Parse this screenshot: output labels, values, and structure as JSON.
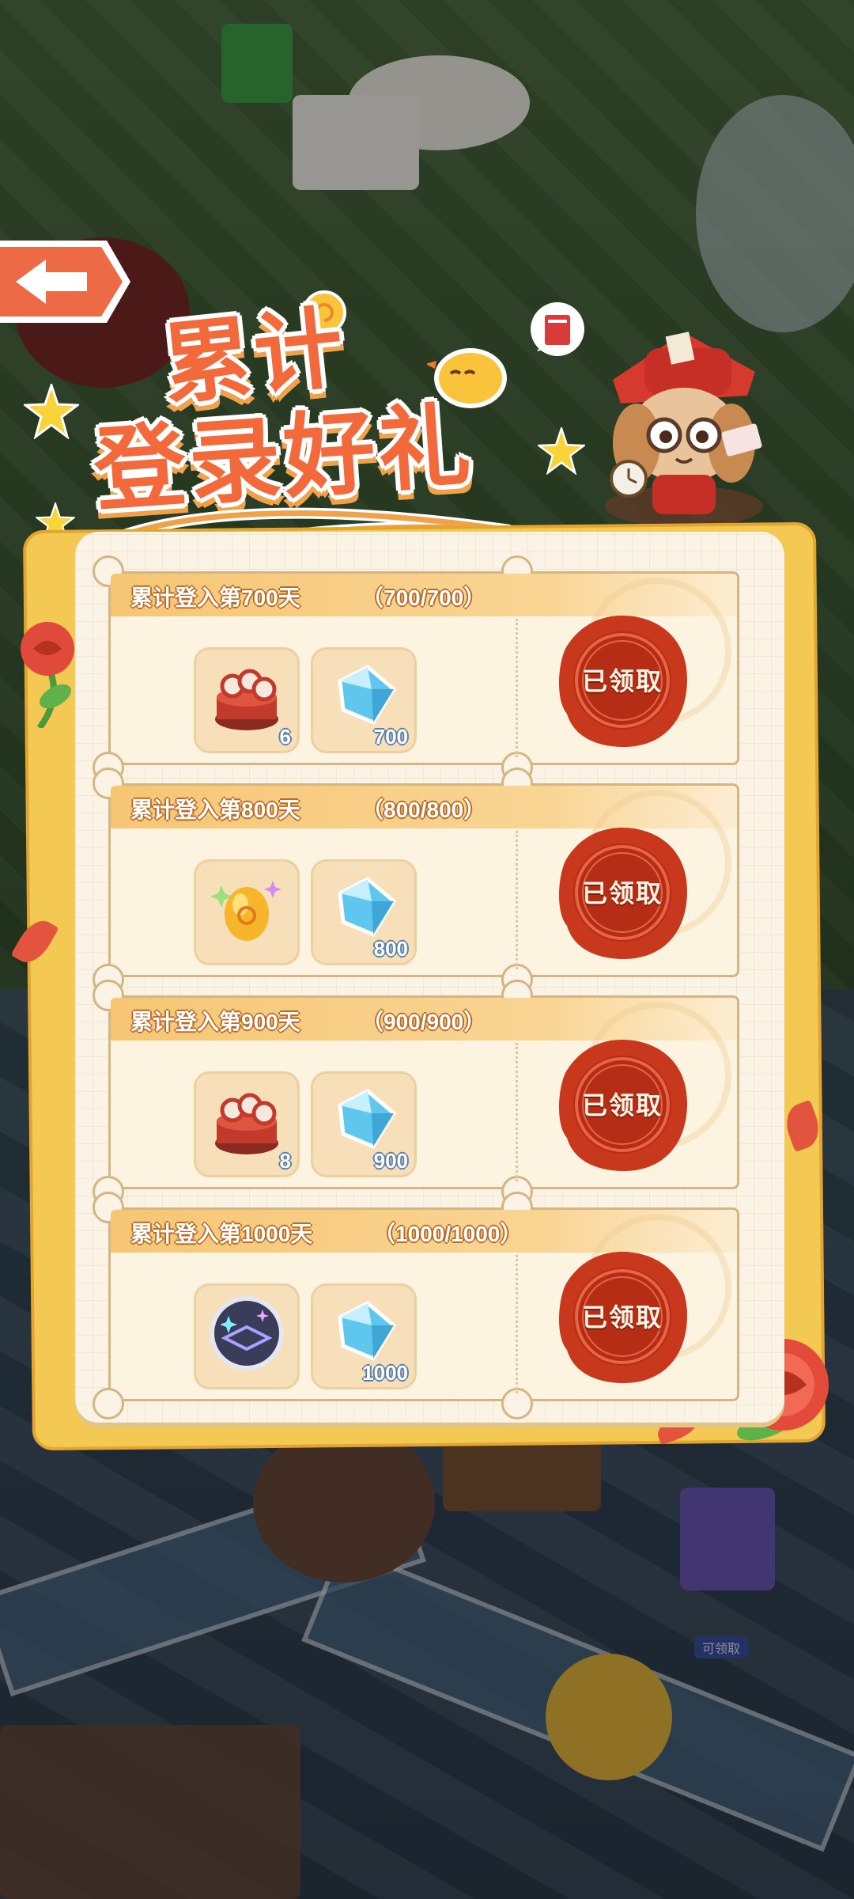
{
  "title": {
    "line1": "累计",
    "line2": "登录好礼"
  },
  "icons": {
    "back": "back-arrow-icon",
    "book": "book-icon",
    "diamond": "diamond-icon",
    "pancake_stack": "pancake-stack-icon",
    "golden_egg": "golden-egg-icon",
    "rune_circle": "rune-circle-icon"
  },
  "rewards": [
    {
      "title": "累计登入第700天",
      "progress": "（700/700）",
      "items": [
        {
          "icon": "pancake-stack-icon",
          "count": "6"
        },
        {
          "icon": "diamond-icon",
          "count": "700"
        }
      ],
      "status": "已领取"
    },
    {
      "title": "累计登入第800天",
      "progress": "（800/800）",
      "items": [
        {
          "icon": "golden-egg-icon",
          "count": ""
        },
        {
          "icon": "diamond-icon",
          "count": "800"
        }
      ],
      "status": "已领取"
    },
    {
      "title": "累计登入第900天",
      "progress": "（900/900）",
      "items": [
        {
          "icon": "pancake-stack-icon",
          "count": "8"
        },
        {
          "icon": "diamond-icon",
          "count": "900"
        }
      ],
      "status": "已领取"
    },
    {
      "title": "累计登入第1000天",
      "progress": "（1000/1000）",
      "items": [
        {
          "icon": "rune-circle-icon",
          "count": ""
        },
        {
          "icon": "diamond-icon",
          "count": "1000"
        }
      ],
      "status": "已领取"
    }
  ],
  "background": {
    "gift_tag": "可领取"
  },
  "colors": {
    "title": "#f26a3c",
    "panel_border": "#f3c853",
    "seal": "#c8381c"
  }
}
